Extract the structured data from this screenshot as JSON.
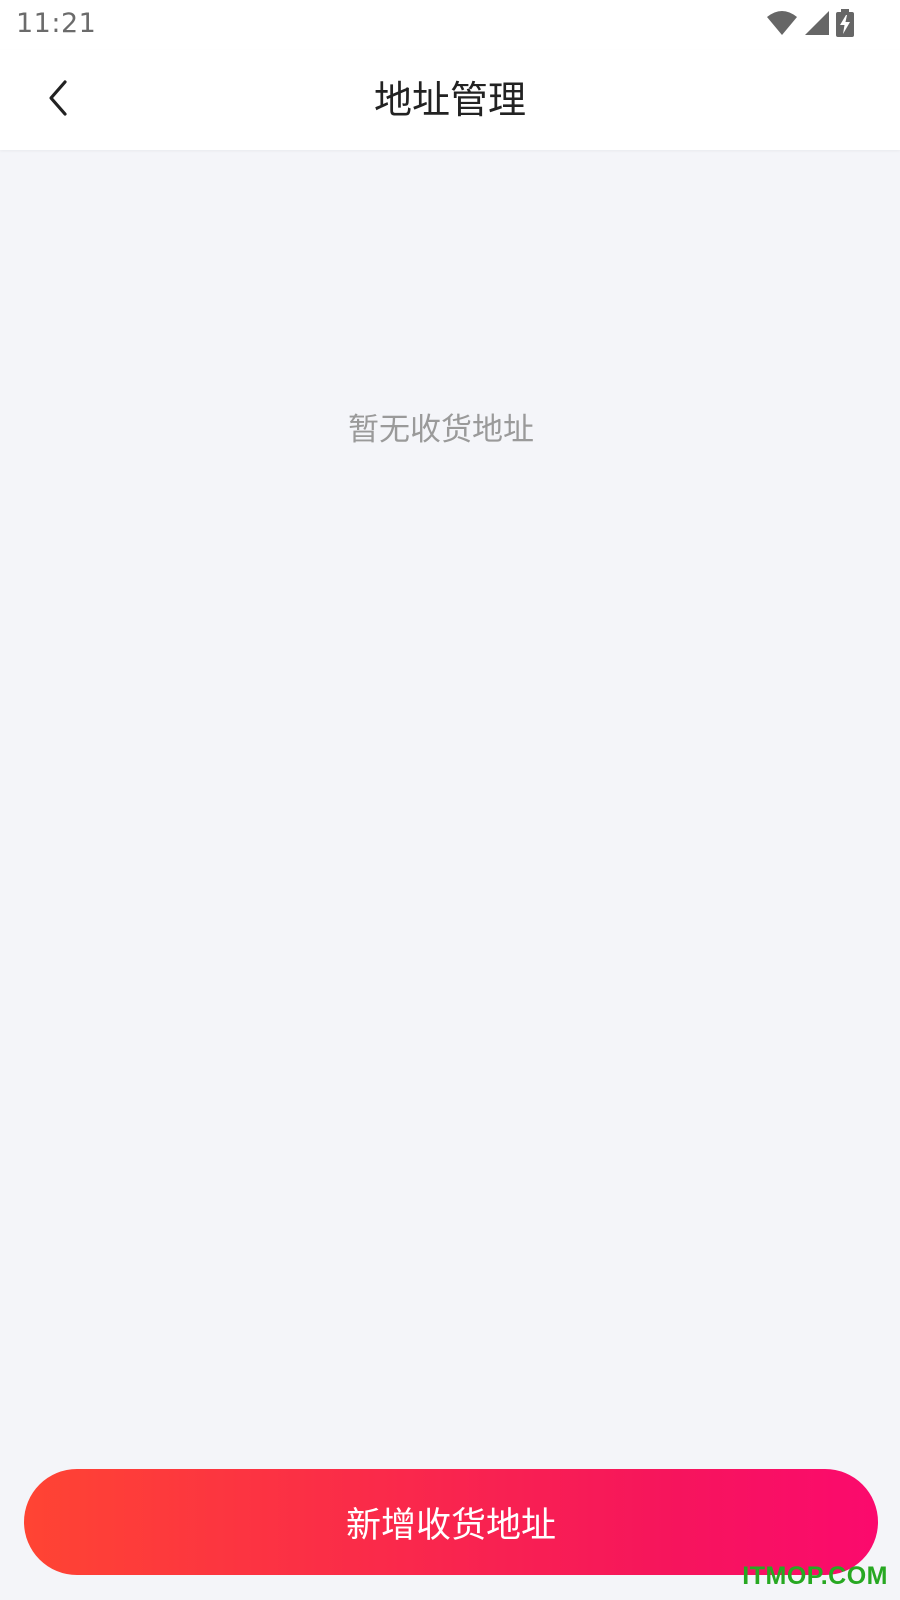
{
  "status_bar": {
    "time": "11:21",
    "icons": [
      "wifi-icon",
      "signal-icon",
      "battery-charging-icon"
    ]
  },
  "header": {
    "title": "地址管理",
    "back_icon": "chevron-left-icon"
  },
  "main": {
    "empty_message": "暂无收货地址"
  },
  "footer": {
    "add_button_label": "新增收货地址"
  },
  "watermark": "ITMOP.COM",
  "colors": {
    "background": "#f4f5f9",
    "button_gradient_start": "#ff4433",
    "button_gradient_end": "#fb0a6d",
    "watermark": "#27a822"
  }
}
